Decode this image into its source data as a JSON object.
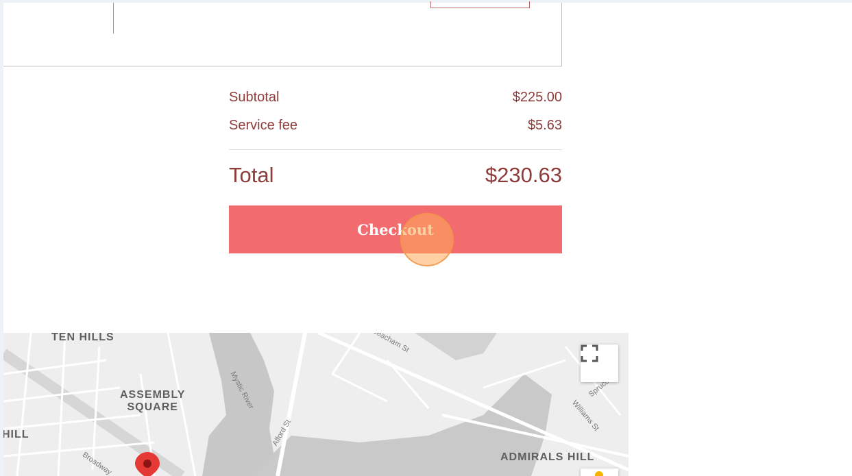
{
  "summary": {
    "subtotal_label": "Subtotal",
    "subtotal_value": "$225.00",
    "service_fee_label": "Service fee",
    "service_fee_value": "$5.63",
    "total_label": "Total",
    "total_value": "$230.63"
  },
  "checkout": {
    "label": "Checkout",
    "color": "#f26b6f"
  },
  "map": {
    "neighborhoods": {
      "ten_hills": "TEN HILLS",
      "assembly_square": "ASSEMBLY\nSQUARE",
      "hill": "HILL",
      "admirals_hill": "ADMIRALS HILL"
    },
    "streets": {
      "mystic_river": "Mystic River",
      "alford_st": "Alford St",
      "beacham_st": "Beacham St",
      "williams_st": "Williams St",
      "spruce_st": "Spruce St",
      "broadway": "Broadway"
    },
    "fullscreen_icon": "fullscreen-icon",
    "marker_icon": "map-pin-icon",
    "pegman_icon": "pegman-icon"
  },
  "colors": {
    "accent_text": "#8d3b3b",
    "button": "#f26b6f",
    "pin": "#e53935"
  }
}
